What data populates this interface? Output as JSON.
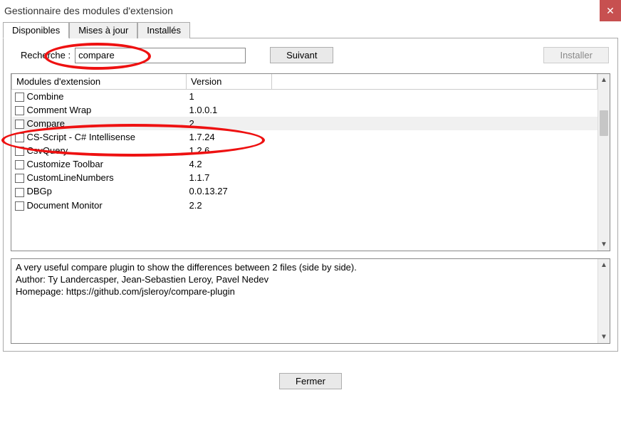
{
  "window": {
    "title": "Gestionnaire des modules d'extension"
  },
  "tabs": {
    "t0": "Disponibles",
    "t1": "Mises à jour",
    "t2": "Installés"
  },
  "search": {
    "label": "Recherche :",
    "value": "compare",
    "next_btn": "Suivant",
    "install_btn": "Installer"
  },
  "columns": {
    "c0": "Modules d'extension",
    "c1": "Version"
  },
  "plugins": [
    {
      "name": "Combine",
      "version": "1"
    },
    {
      "name": "Comment Wrap",
      "version": "1.0.0.1"
    },
    {
      "name": "Compare",
      "version": "2",
      "selected": true
    },
    {
      "name": "CS-Script - C# Intellisense",
      "version": "1.7.24"
    },
    {
      "name": "CsvQuery",
      "version": "1.2.6"
    },
    {
      "name": "Customize Toolbar",
      "version": "4.2"
    },
    {
      "name": "CustomLineNumbers",
      "version": "1.1.7"
    },
    {
      "name": "DBGp",
      "version": "0.0.13.27"
    },
    {
      "name": "Document Monitor",
      "version": "2.2"
    }
  ],
  "description": {
    "line1": "A very useful compare plugin to show the differences between 2 files (side by side).",
    "line2": "Author: Ty Landercasper, Jean-Sebastien Leroy, Pavel Nedev",
    "line3": "Homepage: https://github.com/jsleroy/compare-plugin"
  },
  "footer": {
    "close_btn": "Fermer"
  }
}
